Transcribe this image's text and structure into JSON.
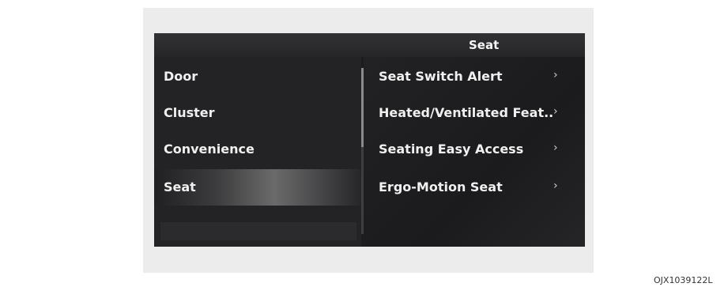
{
  "header": {
    "title": "Seat"
  },
  "left_menu": {
    "items": [
      {
        "label": "Door"
      },
      {
        "label": "Cluster"
      },
      {
        "label": "Convenience"
      },
      {
        "label": "Seat",
        "selected": true
      }
    ]
  },
  "right_menu": {
    "items": [
      {
        "label": "Seat Switch Alert",
        "icon": "chevron-right-icon",
        "chevron": "›"
      },
      {
        "label": "Heated/Ventilated Feat..",
        "icon": "chevron-right-icon",
        "chevron": "›"
      },
      {
        "label": "Seating Easy Access",
        "icon": "chevron-right-icon",
        "chevron": "›"
      },
      {
        "label": "Ergo-Motion Seat",
        "icon": "chevron-right-icon",
        "chevron": "›"
      }
    ]
  },
  "caption": "OJX1039122L",
  "colors": {
    "screen_bg": "#1d1d1f",
    "text": "#f0f0f0",
    "panel_bg": "#ececec"
  }
}
